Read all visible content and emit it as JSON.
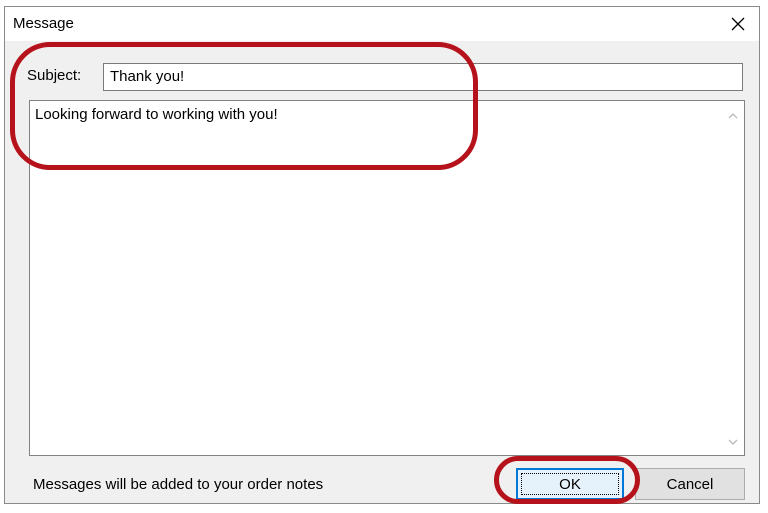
{
  "window": {
    "title": "Message"
  },
  "form": {
    "subject_label": "Subject:",
    "subject_value": "Thank you!",
    "body_value": "Looking forward to working with you!"
  },
  "footer": {
    "note": "Messages will be added to your order notes",
    "ok_label": "OK",
    "cancel_label": "Cancel"
  },
  "icons": {
    "close": "close-icon",
    "scroll_up": "chevron-up-icon",
    "scroll_down": "chevron-down-icon"
  },
  "colors": {
    "annotation": "#b5121b",
    "focus": "#0078d7",
    "dialog_bg": "#f0f0f0"
  }
}
